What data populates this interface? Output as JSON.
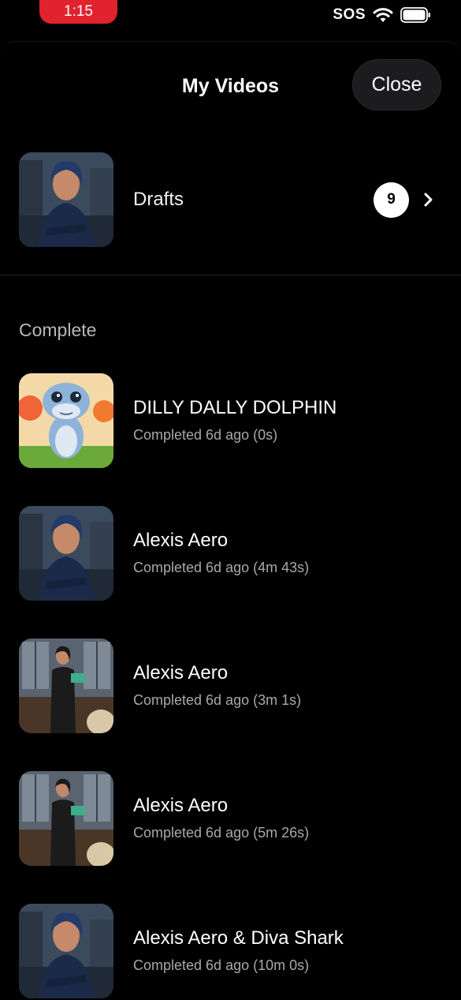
{
  "status": {
    "time": "1:15",
    "sos": "SOS"
  },
  "header": {
    "title": "My Videos",
    "close_label": "Close"
  },
  "drafts": {
    "label": "Drafts",
    "count": "9"
  },
  "section": {
    "title": "Complete"
  },
  "videos": [
    {
      "title": "DILLY DALLY DOLPHIN",
      "subtitle": "Completed 6d ago (0s)",
      "thumb": "dolphin-thumbnail"
    },
    {
      "title": "Alexis Aero",
      "subtitle": "Completed 6d ago (4m 43s)",
      "thumb": "woman-portrait-thumbnail"
    },
    {
      "title": "Alexis Aero",
      "subtitle": "Completed 6d ago (3m 1s)",
      "thumb": "woman-office-thumbnail"
    },
    {
      "title": "Alexis Aero",
      "subtitle": "Completed 6d ago (5m 26s)",
      "thumb": "woman-office-thumbnail"
    },
    {
      "title": "Alexis Aero & Diva Shark",
      "subtitle": "Completed 6d ago (10m 0s)",
      "thumb": "woman-portrait-thumbnail"
    }
  ],
  "colors": {
    "accent_red": "#e0232d",
    "background": "#000000",
    "subtitle_gray": "#a9a9a9"
  }
}
